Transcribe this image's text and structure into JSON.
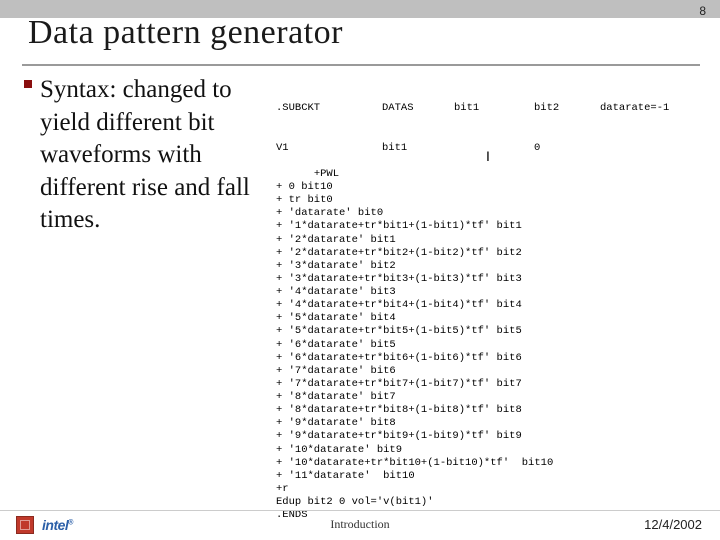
{
  "page_number": "8",
  "title": "Data pattern generator",
  "bullet": {
    "lead": "Syntax:",
    "rest": " changed to yield different bit waveforms with different rise and fall times."
  },
  "code": {
    "header1": {
      "c0": ".SUBCKT",
      "c1": "DATAS",
      "c2": "bit1",
      "c3": "bit2",
      "c4": "datarate=-1"
    },
    "header2": {
      "c0": "V1",
      "c1": "bit1",
      "c2": "",
      "c3": "0"
    },
    "lines": [
      "+PWL",
      "+ 0 bit10",
      "+ tr bit0",
      "+ 'datarate' bit0",
      "+ '1*datarate+tr*bit1+(1-bit1)*tf' bit1",
      "+ '2*datarate' bit1",
      "+ '2*datarate+tr*bit2+(1-bit2)*tf' bit2",
      "+ '3*datarate' bit2",
      "+ '3*datarate+tr*bit3+(1-bit3)*tf' bit3",
      "+ '4*datarate' bit3",
      "+ '4*datarate+tr*bit4+(1-bit4)*tf' bit4",
      "+ '5*datarate' bit4",
      "+ '5*datarate+tr*bit5+(1-bit5)*tf' bit5",
      "+ '6*datarate' bit5",
      "+ '6*datarate+tr*bit6+(1-bit6)*tf' bit6",
      "+ '7*datarate' bit6",
      "+ '7*datarate+tr*bit7+(1-bit7)*tf' bit7",
      "+ '8*datarate' bit7",
      "+ '8*datarate+tr*bit8+(1-bit8)*tf' bit8",
      "+ '9*datarate' bit8",
      "+ '9*datarate+tr*bit9+(1-bit9)*tf' bit9",
      "+ '10*datarate' bit9",
      "+ '10*datarate+tr*bit10+(1-bit10)*tf'  bit10",
      "+ '11*datarate'  bit10",
      "+r",
      "Edup bit2 0 vol='v(bit1)'",
      ".ENDS"
    ]
  },
  "footer": {
    "center": "Introduction",
    "date": "12/4/2002",
    "intel_label": "intel",
    "intel_r": "®"
  }
}
